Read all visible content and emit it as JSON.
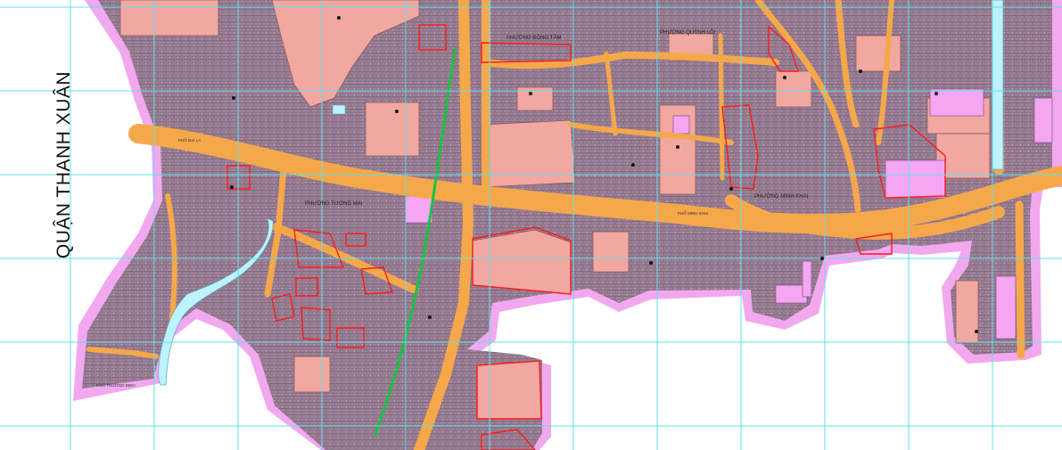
{
  "map": {
    "district_label": "QUẬN THANH XUÂN",
    "colors": {
      "background": "#ffffff",
      "district_border": "#f2a8ef",
      "residential": "#9a7e94",
      "road": "#f5a84a",
      "public_land": "#f2a7a1",
      "pink_land": "#f4a6f2",
      "planning_boundary": "#ff1a1a",
      "green_line": "#19c340",
      "water": "#bdf2ff",
      "grid": "#5fe0ee"
    },
    "ward_labels": [
      "PHƯỜNG ĐỒNG TÂM",
      "PHƯỜNG QUỲNH LÔI",
      "PHƯỜNG TƯƠNG MAI",
      "PHƯỜNG MINH KHAI"
    ],
    "road_labels": [
      "PHỐ ĐẠI LA",
      "PHỐ MINH KHAI",
      "PHỐ TRƯƠNG ĐỊNH"
    ]
  }
}
